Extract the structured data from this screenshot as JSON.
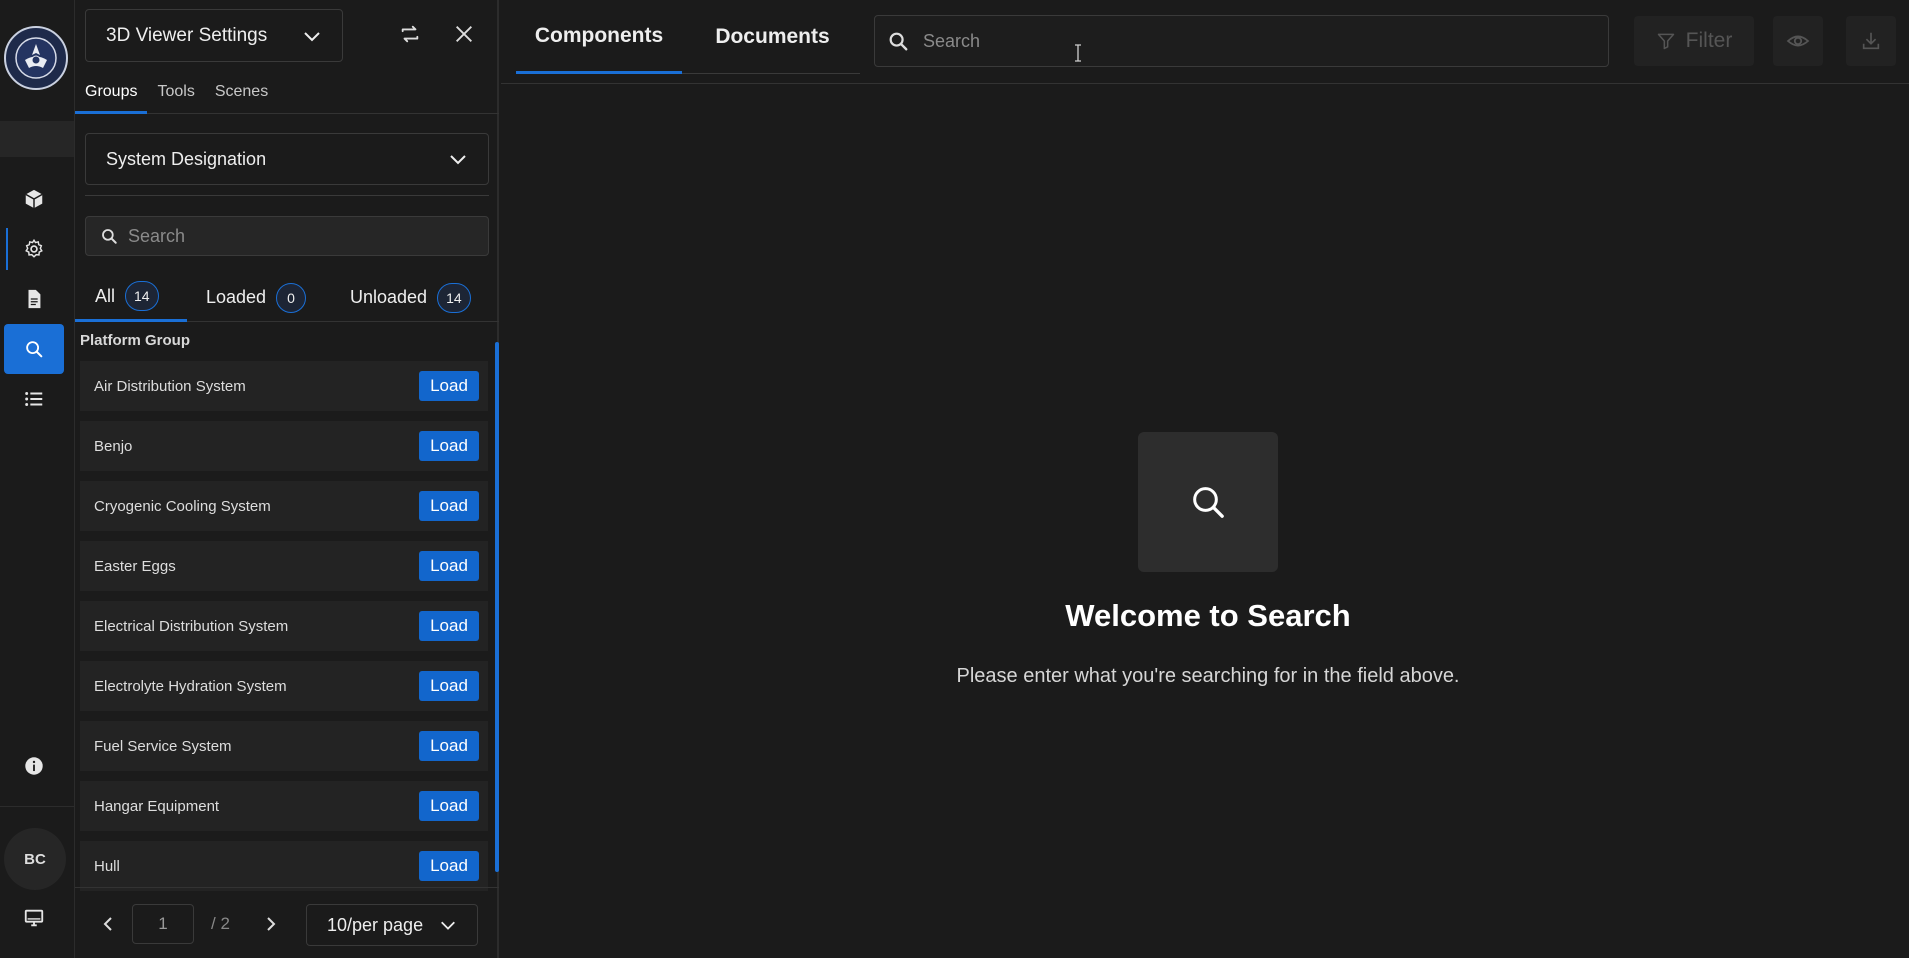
{
  "rail": {
    "logo": "navy-seal-logo",
    "items": [
      {
        "name": "cube-icon"
      },
      {
        "name": "gear-icon"
      },
      {
        "name": "document-icon"
      },
      {
        "name": "search-icon"
      },
      {
        "name": "list-icon"
      }
    ],
    "info_icon": "info-icon",
    "avatar_initials": "BC",
    "monitor_icon": "monitor-icon"
  },
  "panel": {
    "viewer_select": "3D Viewer Settings",
    "subtabs": [
      "Groups",
      "Tools",
      "Scenes"
    ],
    "group_by": "System Designation",
    "search_placeholder": "Search",
    "filters": [
      {
        "label": "All",
        "count": "14"
      },
      {
        "label": "Loaded",
        "count": "0"
      },
      {
        "label": "Unloaded",
        "count": "14"
      }
    ],
    "group_header": "Platform Group",
    "items": [
      {
        "label": "Air Distribution System",
        "action": "Load"
      },
      {
        "label": "Benjo",
        "action": "Load"
      },
      {
        "label": "Cryogenic Cooling System",
        "action": "Load"
      },
      {
        "label": "Easter Eggs",
        "action": "Load"
      },
      {
        "label": "Electrical Distribution System",
        "action": "Load"
      },
      {
        "label": "Electrolyte Hydration System",
        "action": "Load"
      },
      {
        "label": "Fuel Service System",
        "action": "Load"
      },
      {
        "label": "Hangar Equipment",
        "action": "Load"
      },
      {
        "label": "Hull",
        "action": "Load"
      }
    ],
    "pager": {
      "current_page": "1",
      "total": "/ 2",
      "per_page": "10/per page"
    }
  },
  "main": {
    "tabs": [
      "Components",
      "Documents"
    ],
    "search_placeholder": "Search",
    "filter_label": "Filter",
    "welcome_title": "Welcome to Search",
    "welcome_sub": "Please enter what you're searching for in the field above."
  },
  "colors": {
    "accent": "#1a6fd6",
    "background": "#1b1b1b",
    "load_button": "#1266cc"
  }
}
